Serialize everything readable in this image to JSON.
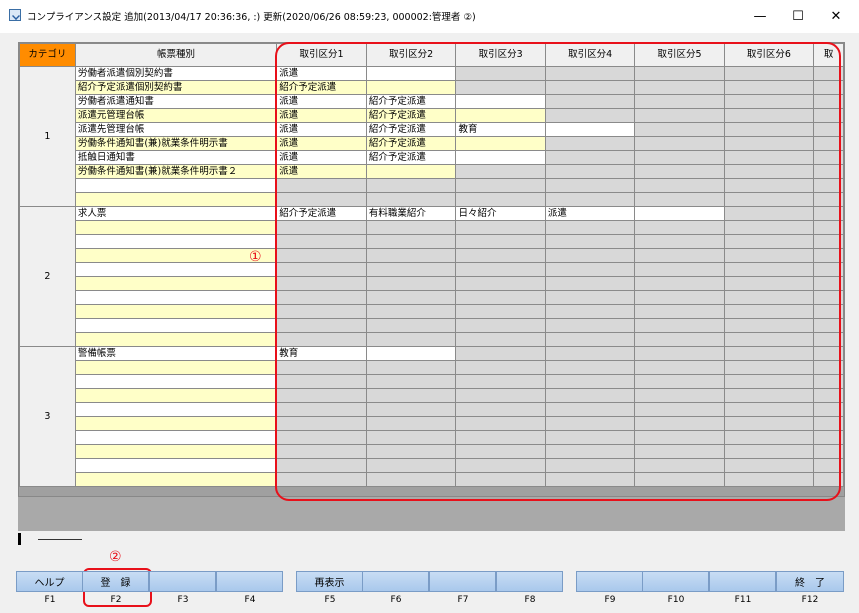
{
  "window": {
    "title": "コンプライアンス設定 追加(2013/04/17 20:36:36, :) 更新(2020/06/26 08:59:23, 000002:管理者 ②)",
    "minimize": "—",
    "maximize": "☐",
    "close": "✕"
  },
  "grid": {
    "headers": {
      "category": "カテゴリ",
      "form_type": "帳票種別",
      "cols": [
        "取引区分1",
        "取引区分2",
        "取引区分3",
        "取引区分4",
        "取引区分5",
        "取引区分6",
        "取"
      ]
    },
    "categories": [
      {
        "label": "1",
        "rows": [
          {
            "name": "労働者派遣個別契約書",
            "cells": [
              "派遣",
              "",
              "",
              "",
              "",
              "",
              ""
            ]
          },
          {
            "name": "紹介予定派遣個別契約書",
            "cells": [
              "紹介予定派遣",
              "",
              "",
              "",
              "",
              "",
              ""
            ]
          },
          {
            "name": "労働者派遣通知書",
            "cells": [
              "派遣",
              "紹介予定派遣",
              "",
              "",
              "",
              "",
              ""
            ]
          },
          {
            "name": "派遣元管理台帳",
            "cells": [
              "派遣",
              "紹介予定派遣",
              "",
              "",
              "",
              "",
              ""
            ]
          },
          {
            "name": "派遣先管理台帳",
            "cells": [
              "派遣",
              "紹介予定派遣",
              "教育",
              "",
              "",
              "",
              ""
            ]
          },
          {
            "name": "労働条件通知書(兼)就業条件明示書",
            "cells": [
              "派遣",
              "紹介予定派遣",
              "",
              "",
              "",
              "",
              ""
            ]
          },
          {
            "name": "抵触日通知書",
            "cells": [
              "派遣",
              "紹介予定派遣",
              "",
              "",
              "",
              "",
              ""
            ]
          },
          {
            "name": "労働条件通知書(兼)就業条件明示書２",
            "cells": [
              "派遣",
              "",
              "",
              "",
              "",
              "",
              ""
            ]
          },
          {
            "name": "",
            "cells": [
              "",
              "",
              "",
              "",
              "",
              "",
              ""
            ]
          },
          {
            "name": "",
            "cells": [
              "",
              "",
              "",
              "",
              "",
              "",
              ""
            ]
          }
        ]
      },
      {
        "label": "2",
        "rows": [
          {
            "name": "求人票",
            "cells": [
              "紹介予定派遣",
              "有料職業紹介",
              "日々紹介",
              "派遣",
              "",
              "",
              ""
            ]
          },
          {
            "name": "",
            "cells": [
              "",
              "",
              "",
              "",
              "",
              "",
              ""
            ]
          },
          {
            "name": "",
            "cells": [
              "",
              "",
              "",
              "",
              "",
              "",
              ""
            ]
          },
          {
            "name": "",
            "cells": [
              "",
              "",
              "",
              "",
              "",
              "",
              ""
            ]
          },
          {
            "name": "",
            "cells": [
              "",
              "",
              "",
              "",
              "",
              "",
              ""
            ]
          },
          {
            "name": "",
            "cells": [
              "",
              "",
              "",
              "",
              "",
              "",
              ""
            ]
          },
          {
            "name": "",
            "cells": [
              "",
              "",
              "",
              "",
              "",
              "",
              ""
            ]
          },
          {
            "name": "",
            "cells": [
              "",
              "",
              "",
              "",
              "",
              "",
              ""
            ]
          },
          {
            "name": "",
            "cells": [
              "",
              "",
              "",
              "",
              "",
              "",
              ""
            ]
          },
          {
            "name": "",
            "cells": [
              "",
              "",
              "",
              "",
              "",
              "",
              ""
            ]
          }
        ]
      },
      {
        "label": "3",
        "rows": [
          {
            "name": "警備帳票",
            "cells": [
              "教育",
              "",
              "",
              "",
              "",
              "",
              ""
            ]
          },
          {
            "name": "",
            "cells": [
              "",
              "",
              "",
              "",
              "",
              "",
              ""
            ]
          },
          {
            "name": "",
            "cells": [
              "",
              "",
              "",
              "",
              "",
              "",
              ""
            ]
          },
          {
            "name": "",
            "cells": [
              "",
              "",
              "",
              "",
              "",
              "",
              ""
            ]
          },
          {
            "name": "",
            "cells": [
              "",
              "",
              "",
              "",
              "",
              "",
              ""
            ]
          },
          {
            "name": "",
            "cells": [
              "",
              "",
              "",
              "",
              "",
              "",
              ""
            ]
          },
          {
            "name": "",
            "cells": [
              "",
              "",
              "",
              "",
              "",
              "",
              ""
            ]
          },
          {
            "name": "",
            "cells": [
              "",
              "",
              "",
              "",
              "",
              "",
              ""
            ]
          },
          {
            "name": "",
            "cells": [
              "",
              "",
              "",
              "",
              "",
              "",
              ""
            ]
          },
          {
            "name": "",
            "cells": [
              "",
              "",
              "",
              "",
              "",
              "",
              ""
            ]
          }
        ]
      }
    ]
  },
  "annotations": {
    "one": "①",
    "two": "②"
  },
  "fkeys": [
    {
      "label": "ヘルプ",
      "key": "F1"
    },
    {
      "label": "登　録",
      "key": "F2"
    },
    {
      "label": "",
      "key": "F3"
    },
    {
      "label": "",
      "key": "F4"
    },
    {
      "label": "再表示",
      "key": "F5"
    },
    {
      "label": "",
      "key": "F6"
    },
    {
      "label": "",
      "key": "F7"
    },
    {
      "label": "",
      "key": "F8"
    },
    {
      "label": "",
      "key": "F9"
    },
    {
      "label": "",
      "key": "F10"
    },
    {
      "label": "",
      "key": "F11"
    },
    {
      "label": "終　了",
      "key": "F12"
    }
  ]
}
